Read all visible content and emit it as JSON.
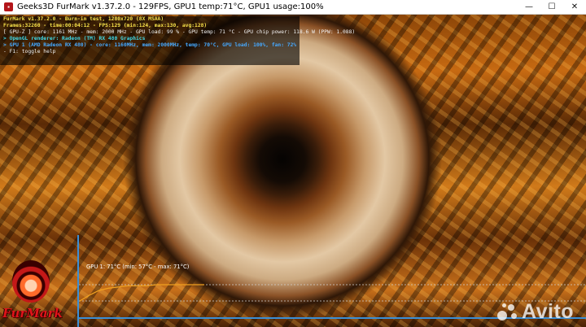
{
  "window": {
    "title": "Geeks3D FurMark v1.37.2.0 - 129FPS, GPU1 temp:71°C, GPU1 usage:100%",
    "controls": {
      "minimize": "—",
      "maximize": "☐",
      "close": "✕"
    }
  },
  "overlay": {
    "line1": "FurMark v1.37.2.0 - Burn-in test, 1280x720 (8X MSAA)",
    "line2": "Frames:32260 - time:00:04:12 - FPS:129 (min:124, max:130, avg:128)",
    "line3": "[ GPU-Z ] core: 1161 MHz - mem: 2000 MHz - GPU load: 99 % - GPU temp: 71 °C - GPU chip power: 118.6 W (PPW: 1.088)",
    "line4": "> OpenGL renderer: Radeon (TM) RX 480 Graphics",
    "line5": "> GPU 1 (AMD Radeon RX 480) - core: 1160MHz, mem: 2000MHz, temp: 70°C, GPU load: 100%, fan: 72%",
    "line6": "- F1: toggle help"
  },
  "temp_graph": {
    "label": "GPU 1: 71°C (min: 57°C - max: 71°C)",
    "line_color": "#f0a020",
    "axis_color": "#3b8fd6",
    "temperature_samples": [
      57,
      62,
      66,
      68,
      69,
      70,
      70,
      70,
      71,
      71,
      71,
      71,
      71,
      71
    ]
  },
  "logo": {
    "text": "FurMark",
    "color": "#e1141a"
  },
  "watermark": {
    "text": "Avito"
  }
}
